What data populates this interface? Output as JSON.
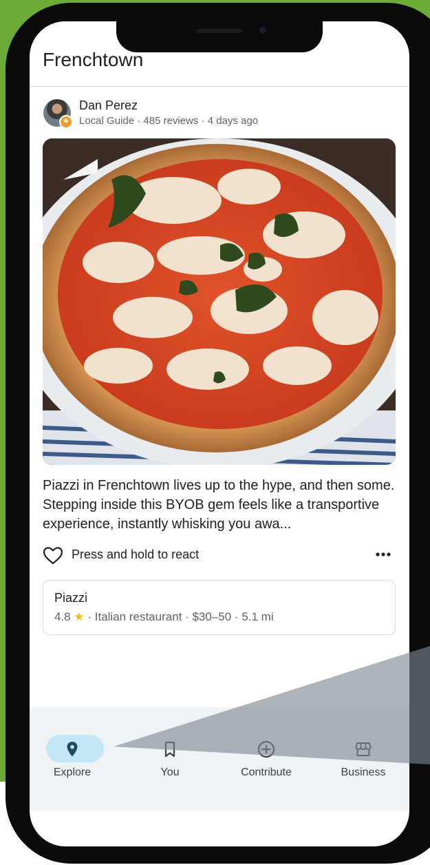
{
  "header": {
    "title": "Frenchtown"
  },
  "review": {
    "reviewer_name": "Dan Perez",
    "reviewer_meta": "Local Guide · 485 reviews · 4 days ago",
    "text": "Piazzi in Frenchtown lives up to the hype, and then some. Stepping inside this BYOB gem feels like a transportive experience, instantly whisking you awa...",
    "react_label": "Press and hold to react"
  },
  "place": {
    "name": "Piazzi",
    "rating": "4.8",
    "details": "· Italian restaurant · $30–50 · 5.1 mi"
  },
  "nav": {
    "items": [
      {
        "label": "Explore",
        "icon": "location-pin-icon",
        "active": true
      },
      {
        "label": "You",
        "icon": "bookmark-icon",
        "active": false
      },
      {
        "label": "Contribute",
        "icon": "add-circle-icon",
        "active": false
      },
      {
        "label": "Business",
        "icon": "storefront-icon",
        "active": false
      }
    ]
  },
  "colors": {
    "background_green": "#6cac36",
    "active_pill": "#c3e7f6",
    "nav_background": "#eef3f6",
    "star": "#fbbc04",
    "badge": "#f29a2e"
  }
}
